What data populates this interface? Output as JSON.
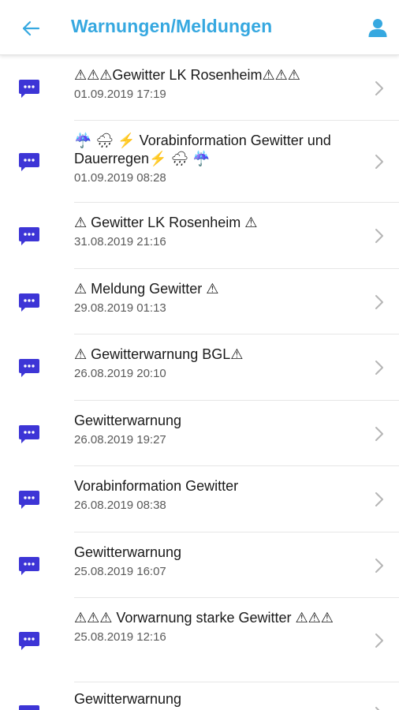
{
  "header": {
    "title": "Warnungen/Meldungen",
    "back_icon": "arrow-left-icon",
    "profile_icon": "user-icon",
    "accent_color": "#36a8e0"
  },
  "messages": [
    {
      "title": "⚠⚠⚠Gewitter LK Rosenheim⚠⚠⚠",
      "date": "01.09.2019 17:19"
    },
    {
      "title": "☔ 🌧 ⚡ Vorabinformation Gewitter und Dauerregen⚡ 🌧 ☔",
      "date": "01.09.2019 08:28"
    },
    {
      "title": "⚠ Gewitter LK Rosenheim ⚠",
      "date": "31.08.2019 21:16"
    },
    {
      "title": "⚠ Meldung Gewitter ⚠",
      "date": "29.08.2019 01:13"
    },
    {
      "title": "⚠ Gewitterwarnung BGL⚠",
      "date": "26.08.2019 20:10"
    },
    {
      "title": "Gewitterwarnung",
      "date": "26.08.2019 19:27"
    },
    {
      "title": "Vorabinformation Gewitter",
      "date": "26.08.2019 08:38"
    },
    {
      "title": "Gewitterwarnung",
      "date": "25.08.2019 16:07"
    },
    {
      "title": "⚠⚠⚠ Vorwarnung starke Gewitter ⚠⚠⚠",
      "date": "25.08.2019 12:16"
    },
    {
      "title": "Gewitterwarnung",
      "date": ""
    }
  ],
  "icons": {
    "message_icon": "message-bubble-icon",
    "message_icon_color": "#3d35d6",
    "chevron": "chevron-right-icon"
  }
}
